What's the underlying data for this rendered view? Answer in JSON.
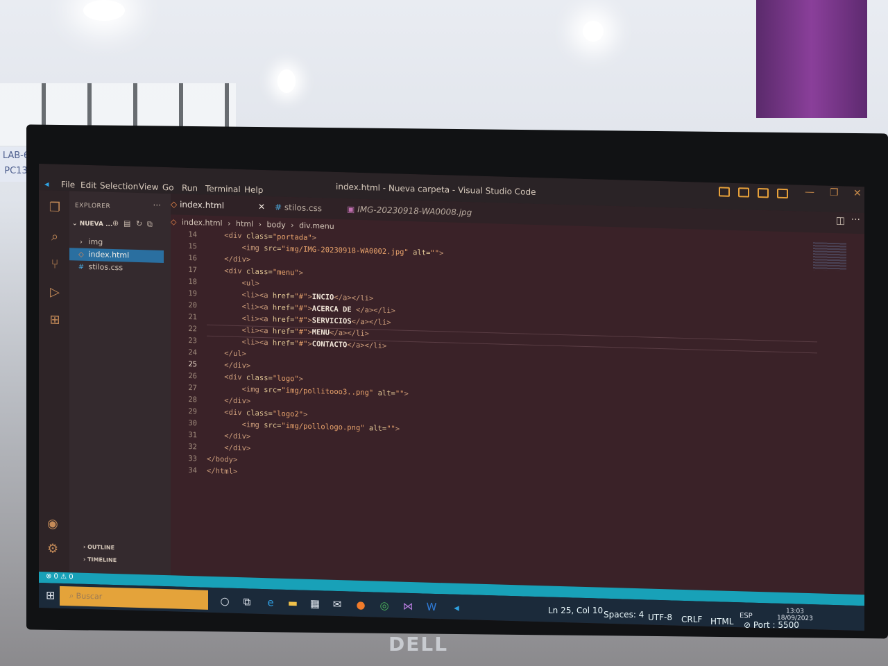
{
  "room": {
    "sign": "LAB-6\nPC13"
  },
  "monitor": {
    "brand": "DELL"
  },
  "titlebar": {
    "menu": [
      "File",
      "Edit",
      "Selection",
      "View",
      "Go",
      "Run",
      "Terminal",
      "Help"
    ],
    "title": "index.html - Nueva carpeta - Visual Studio Code"
  },
  "sidebar": {
    "title": "EXPLORER",
    "folder": "NUEVA ...",
    "items": [
      {
        "label": "img",
        "icon": "chevron-right-icon"
      },
      {
        "label": "index.html",
        "icon": "html-icon"
      },
      {
        "label": "stilos.css",
        "icon": "css-icon"
      }
    ],
    "outline": "OUTLINE",
    "timeline": "TIMELINE"
  },
  "tabs": [
    {
      "label": "index.html",
      "active": true
    },
    {
      "label": "stilos.css",
      "active": false
    },
    {
      "label": "IMG-20230918-WA0008.jpg",
      "active": false
    }
  ],
  "breadcrumb": [
    "index.html",
    "html",
    "body",
    "div.menu"
  ],
  "code": {
    "lines": [
      {
        "n": "14",
        "text": "    <div class=\"portada\">"
      },
      {
        "n": "15",
        "text": "        <img src=\"img/IMG-20230918-WA0002.jpg\" alt=\"\">"
      },
      {
        "n": "16",
        "text": "    </div>"
      },
      {
        "n": "17",
        "text": "    <div class=\"menu\">"
      },
      {
        "n": "18",
        "text": "        <ul>"
      },
      {
        "n": "19",
        "text": "        <li><a href=\"#\">INCIO</a></li>"
      },
      {
        "n": "20",
        "text": "        <li><a href=\"#\">ACERCA DE </a></li>"
      },
      {
        "n": "21",
        "text": "        <li><a href=\"#\">SERVICIOS</a></li>"
      },
      {
        "n": "22",
        "text": "        <li><a href=\"#\">MENU</a></li>"
      },
      {
        "n": "23",
        "text": "        <li><a href=\"#\">CONTACTO</a></li>"
      },
      {
        "n": "24",
        "text": "    </ul>"
      },
      {
        "n": "25",
        "text": "    </div>"
      },
      {
        "n": "26",
        "text": "    <div class=\"logo\">"
      },
      {
        "n": "27",
        "text": "        <img src=\"img/pollitooo3..png\" alt=\"\">"
      },
      {
        "n": "28",
        "text": "    </div>"
      },
      {
        "n": "29",
        "text": "    <div class=\"logo2\">"
      },
      {
        "n": "30",
        "text": "        <img src=\"img/pollologo.png\" alt=\"\">"
      },
      {
        "n": "31",
        "text": "    </div>"
      },
      {
        "n": "32",
        "text": "    </div>"
      },
      {
        "n": "33",
        "text": "</body>"
      },
      {
        "n": "34",
        "text": "</html>"
      }
    ],
    "current_line": "25"
  },
  "status": {
    "problems": "⊗ 0 ⚠ 0",
    "position": "Ln 25, Col 10",
    "spaces": "Spaces: 4",
    "encoding": "UTF-8",
    "eol": "CRLF",
    "language": "HTML",
    "port": "⊘ Port : 5500"
  },
  "taskbar": {
    "search_placeholder": "Buscar",
    "lang": "ESP",
    "time": "13:03",
    "date": "18/09/2023"
  },
  "colors": {
    "accent": "#e4a33a",
    "statusbar": "#18a1b8",
    "selection": "#2a6fa0"
  }
}
